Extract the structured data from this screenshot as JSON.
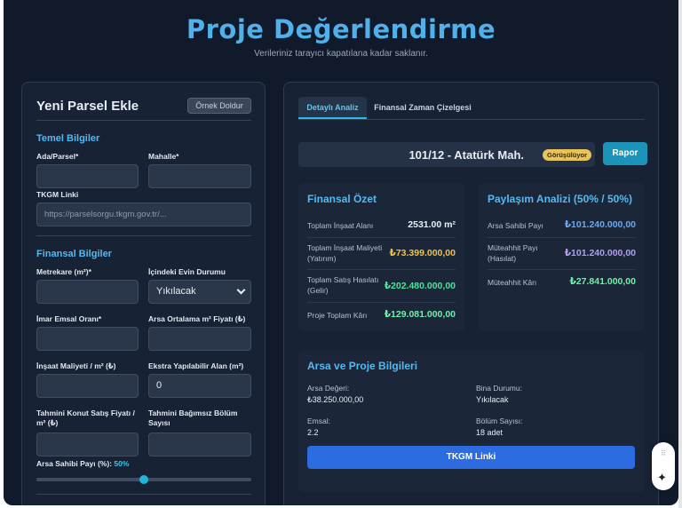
{
  "header": {
    "title": "Proje Değerlendirme",
    "subtitle": "Verileriniz tarayıcı kapatılana kadar saklanır."
  },
  "form": {
    "title": "Yeni Parsel Ekle",
    "fill_button": "Örnek Doldur",
    "basic_section": "Temel Bilgiler",
    "ada_parsel_label": "Ada/Parsel*",
    "ada_parsel_value": "",
    "mahalle_label": "Mahalle*",
    "mahalle_value": "",
    "tkgm_label": "TKGM Linki",
    "tkgm_placeholder": "https://parselsorgu.tkgm.gov.tr/...",
    "finance_section": "Finansal Bilgiler",
    "metrekare_label": "Metrekare (m²)*",
    "metrekare_value": "",
    "ev_durumu_label": "İçindeki Evin Durumu",
    "ev_durumu_value": "Yıkılacak",
    "emsal_label": "İmar Emsal Oranı*",
    "emsal_value": "",
    "arsa_fiyat_label": "Arsa Ortalama m² Fiyatı (₺)",
    "arsa_fiyat_value": "",
    "insaat_maliyeti_label": "İnşaat Maliyeti / m² (₺)",
    "insaat_maliyeti_value": "",
    "ekstra_alan_label": "Ekstra Yapılabilir Alan (m²)",
    "ekstra_alan_value": "0",
    "satis_fiyati_label": "Tahmini Konut Satış Fiyatı / m² (₺)",
    "satis_fiyati_value": "",
    "bolum_sayisi_label": "Tahmini Bağımsız Bölüm Sayısı",
    "bolum_sayisi_value": "",
    "pay_label": "Arsa Sahibi Payı (%):",
    "pay_value": "50%",
    "pay_fraction": 0.5
  },
  "analysis": {
    "tabs": [
      "Detaylı Analiz",
      "Finansal Zaman Çizelgesi"
    ],
    "parcel_name": "101/12 - Atatürk Mah.",
    "status_badge": "Görüşülüyor",
    "report_button": "Rapor",
    "financial_summary": {
      "title": "Finansal Özet",
      "rows": [
        {
          "label": "Toplam İnşaat Alanı",
          "value": "2531.00 m²",
          "color": "#e8edf5"
        },
        {
          "label": "Toplam İnşaat Maliyeti (Yatırım)",
          "value": "₺73.399.000,00",
          "color": "#f0c24b"
        },
        {
          "label": "Toplam Satış Hasılatı (Gelir)",
          "value": "₺202.480.000,00",
          "color": "#4ee39a"
        },
        {
          "label": "Proje Toplam Kârı",
          "value": "₺129.081.000,00",
          "color": "#6ef2a8"
        }
      ]
    },
    "share_analysis": {
      "title": "Paylaşım Analizi (50% / 50%)",
      "rows": [
        {
          "label": "Arsa Sahibi Payı",
          "value": "₺101.240.000,00",
          "color": "#6aa8f5"
        },
        {
          "label": "Müteahhit Payı (Hasılat)",
          "value": "₺101.240.000,00",
          "color": "#b39cf2"
        },
        {
          "label": "Müteahhit Kârı",
          "value": "₺27.841.000,00",
          "color": "#6ef2a8"
        }
      ]
    },
    "project_info": {
      "title": "Arsa ve Proje Bilgileri",
      "arsa_degeri_label": "Arsa Değeri:",
      "arsa_degeri_value": "₺38.250.000,00",
      "bina_durumu_label": "Bina Durumu:",
      "bina_durumu_value": "Yıkılacak",
      "emsal_label": "Emsal:",
      "emsal_value": "2.2",
      "bolum_label": "Bölüm Sayısı:",
      "bolum_value": "18 adet",
      "tkgm_button": "TKGM Linki"
    }
  },
  "colors": {
    "background": "#111a2b",
    "panel": "#172234",
    "accent": "#4fb0ea",
    "primary_button": "#2d6be0"
  }
}
